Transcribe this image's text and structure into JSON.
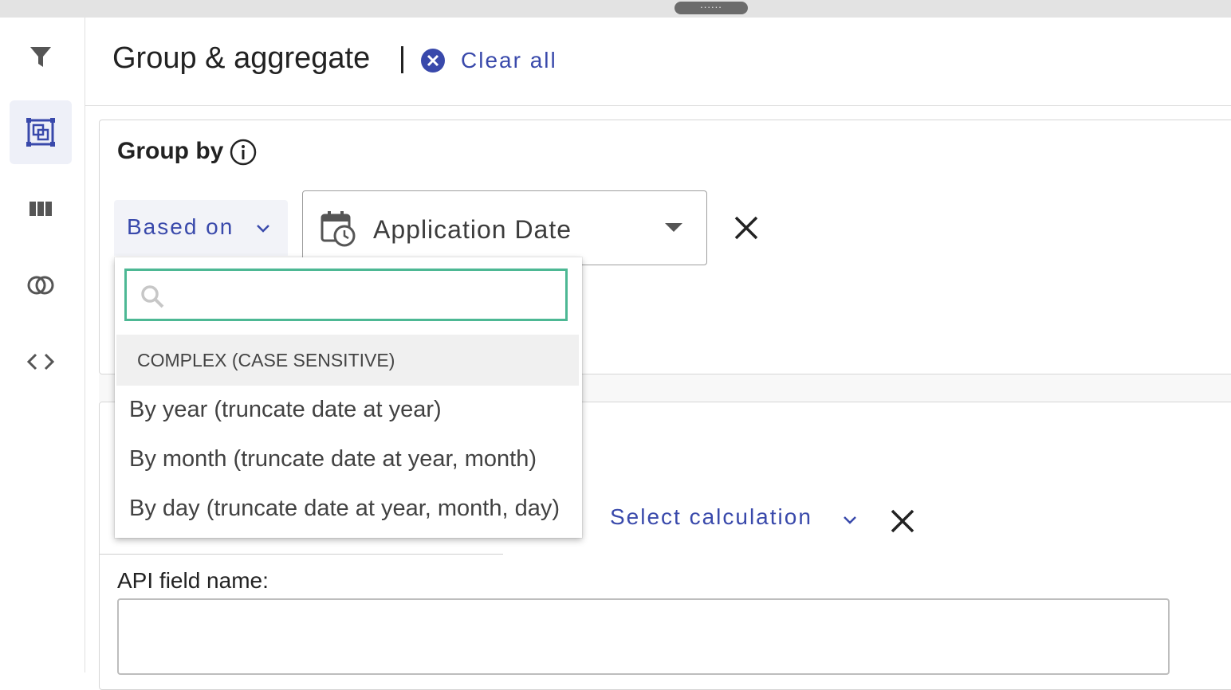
{
  "header": {
    "title": "Group & aggregate",
    "clear_all": "Clear all"
  },
  "sidebar": {
    "items": [
      {
        "icon": "filter-icon",
        "active": false
      },
      {
        "icon": "group-aggregate-icon",
        "active": true
      },
      {
        "icon": "columns-icon",
        "active": false
      },
      {
        "icon": "join-icon",
        "active": false
      },
      {
        "icon": "code-icon",
        "active": false
      }
    ]
  },
  "group_by": {
    "label": "Group by",
    "based_on": "Based on",
    "field": "Application Date",
    "api_field_label": "API field name:",
    "api_field_value": ""
  },
  "aggregate": {
    "select_calculation": "Select calculation"
  },
  "dropdown": {
    "search_value": "",
    "group_label": "COMPLEX (CASE SENSITIVE)",
    "items": [
      "By year (truncate date at year)",
      "By month (truncate date at year, month)",
      "By day (truncate date at year, month, day)"
    ]
  },
  "colors": {
    "accent": "#3949ab",
    "search_focus": "#4db894",
    "active_bg": "#eef0f8"
  }
}
